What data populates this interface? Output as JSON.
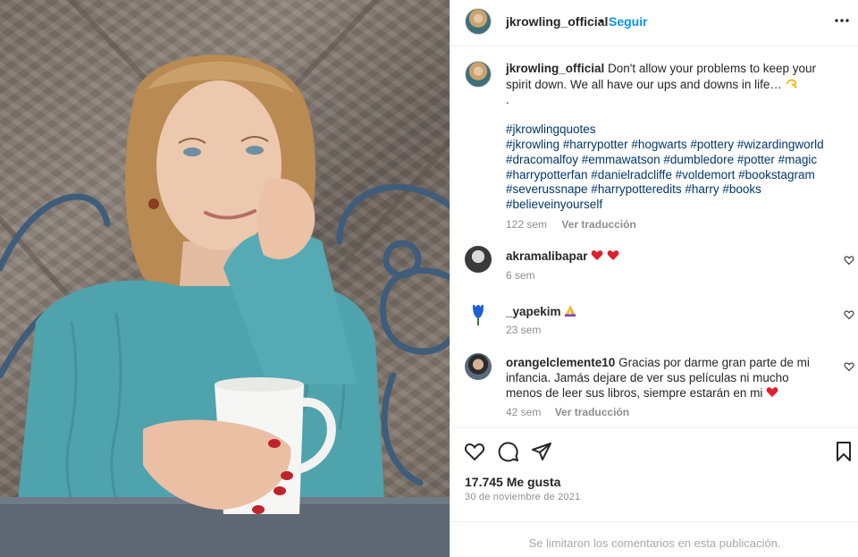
{
  "post": {
    "username": "jkrowling_official",
    "follow_label": "Seguir",
    "separator": "•",
    "caption_text": "Don't allow your problems to keep your spirit down. We all have our ups and downs in life…",
    "caption_dot": ".",
    "hashtags": [
      "#jkrowlingquotes",
      "#jkrowling #harrypotter #hogwarts #pottery #wizardingworld",
      "#dracomalfoy #emmawatson #dumbledore #potter #magic",
      "#harrypotterfan #danielradcliffe #voldemort #bookstagram",
      "#severussnape #harrypotteredits #harry #books",
      "#believeinyourself"
    ],
    "caption_age": "122 sem",
    "translate_label": "Ver traducción",
    "likes": "17.745 Me gusta",
    "date": "30 de noviembre de 2021",
    "comments_limited": "Se limitaron los comentarios en esta publicación."
  },
  "comments": [
    {
      "username": "akramalibapar",
      "text": "",
      "emoji": "red-hearts",
      "age": "6 sem",
      "translate": ""
    },
    {
      "username": "_yapekim",
      "text": "",
      "emoji": "praying-hands",
      "age": "23 sem",
      "translate": ""
    },
    {
      "username": "orangelclemente10",
      "text": "Gracias por darme gran parte de mi infancia. Jamás dejare de ver sus películas ni mucho menos de leer sus libros, siempre estarán en mi",
      "emoji": "red-heart",
      "age": "42 sem",
      "translate": "Ver traducción"
    }
  ],
  "icons": {
    "more": "more-options-icon",
    "like": "heart-icon",
    "comment": "comment-icon",
    "share": "share-icon",
    "save": "bookmark-icon",
    "caption_emoji": "dizzy-icon"
  },
  "colors": {
    "accent": "#0095f6",
    "hashtag": "#00376b",
    "muted": "#8e8e8e",
    "heart": "#ed4956"
  }
}
